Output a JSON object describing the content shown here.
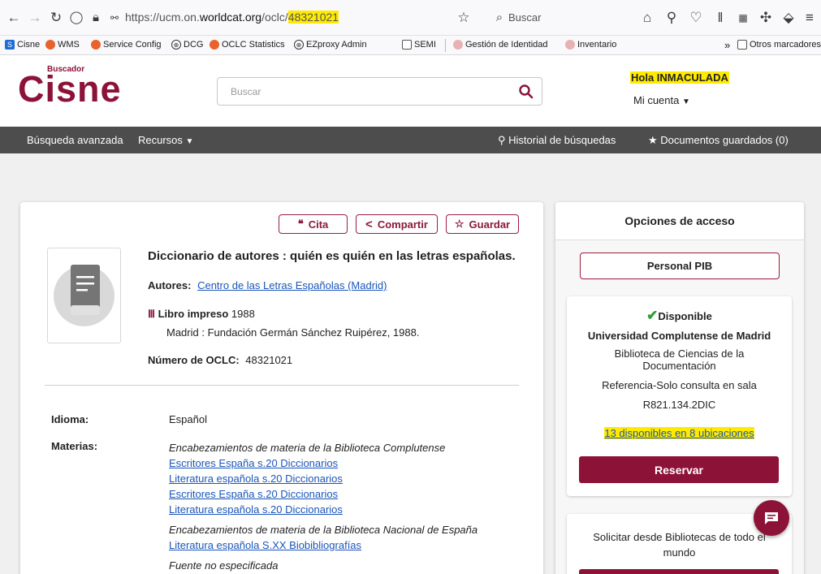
{
  "browser": {
    "url_prefix": "https://ucm.on.",
    "url_domain": "worldcat.org",
    "url_path": "/oclc/",
    "url_highlight": "48321021",
    "search_placeholder": "Buscar"
  },
  "bookmarks": [
    {
      "label": "Cisne",
      "color": "#1f6fd1"
    },
    {
      "label": "WMS",
      "color": "#e8622c"
    },
    {
      "label": "Service Config",
      "color": "#e8622c"
    },
    {
      "label": "DCG",
      "color": "#333333"
    },
    {
      "label": "OCLC Statistics",
      "color": "#e8622c"
    },
    {
      "label": "EZproxy Admin",
      "color": "#333333"
    },
    {
      "label": "SEMI",
      "color": "#555555"
    },
    {
      "label": "Gestión de Identidad",
      "color": "#d48a8a"
    },
    {
      "label": "Inventario",
      "color": "#d48a8a"
    }
  ],
  "bookmarks_more": "Otros marcadores",
  "site": {
    "logo_small": "Buscador",
    "logo_big": "Cisne",
    "search_placeholder": "Buscar",
    "greeting": "Hola INMACULADA",
    "account": "Mi cuenta"
  },
  "nav": {
    "advanced": "Búsqueda avanzada",
    "resources": "Recursos",
    "history": "Historial de búsquedas",
    "saved": "Documentos guardados (0)"
  },
  "record": {
    "cite": "Cita",
    "share": "Compartir",
    "save": "Guardar",
    "title": "Diccionario de autores : quién es quién en las letras españolas.",
    "authors_label": "Autores:",
    "author": "Centro de las Letras Españolas (Madrid)",
    "format": "Libro impreso",
    "year": "1988",
    "publisher": "Madrid : Fundación Germán Sánchez Ruipérez, 1988.",
    "oclc_label": "Número de OCLC:",
    "oclc": "48321021",
    "language_label": "Idioma:",
    "language": "Español",
    "subjects_label": "Materias:",
    "subj_group1": "Encabezamientos de materia de la Biblioteca Complutense",
    "subj_group1_links": [
      "Escritores España s.20 Diccionarios",
      "Literatura española s.20 Diccionarios",
      "Escritores España s.20 Diccionarios",
      "Literatura española s.20 Diccionarios"
    ],
    "subj_group2": "Encabezamientos de materia de la Biblioteca Nacional de España",
    "subj_group2_links": [
      "Literatura española S.XX Biobibliografías"
    ],
    "subj_group3": "Fuente no especificada"
  },
  "access": {
    "heading": "Opciones de acceso",
    "personal": "Personal PIB",
    "status": "Disponible",
    "university": "Universidad Complutense de Madrid",
    "library": "Biblioteca de Ciencias de la Documentación",
    "location": "Referencia-Solo consulta en sala",
    "callnumber": "R821.134.2DIC",
    "availability": "13 disponibles en 8 ubicaciones",
    "reserve": "Reservar",
    "request": "Solicitar desde Bibliotecas de todo el mundo"
  }
}
